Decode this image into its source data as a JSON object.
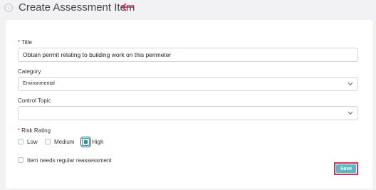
{
  "header": {
    "title": "Create Assessment Item",
    "back_icon": "back-circle-icon",
    "arrow_icon": "left-arrow-icon",
    "arrow_color": "#c8315a"
  },
  "form": {
    "title_label": "Title",
    "title_required_mark": "*",
    "title_value": "Obtain permit relating to building work on this perimeter",
    "category_label": "Category",
    "category_value": "Environmental",
    "control_topic_label": "Control Topic",
    "control_topic_value": "",
    "risk_rating_label": "Risk Rating",
    "risk_rating_required_mark": "*",
    "risk_options": [
      "Low",
      "Medium",
      "High"
    ],
    "risk_selected": "High",
    "reassessment_label": "Item needs regular reassessment",
    "reassessment_checked": false
  },
  "actions": {
    "save_label": "Save",
    "save_color": "#5fb7c4",
    "highlight_color": "#d6335c"
  }
}
